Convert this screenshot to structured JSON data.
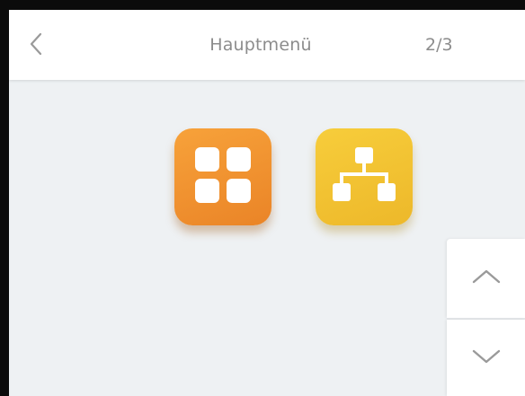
{
  "header": {
    "title": "Hauptmenü",
    "page_indicator": "2/3",
    "back_icon": "chevron-left-icon"
  },
  "apps": [
    {
      "icon": "grid-icon",
      "color": "#f39a33"
    },
    {
      "icon": "network-icon",
      "color": "#f2c433"
    }
  ],
  "scroll": {
    "up_icon": "chevron-up-icon",
    "down_icon": "chevron-down-icon"
  },
  "colors": {
    "background": "#eef1f3",
    "header_bg": "#ffffff",
    "text_muted": "#8c8c8c"
  }
}
